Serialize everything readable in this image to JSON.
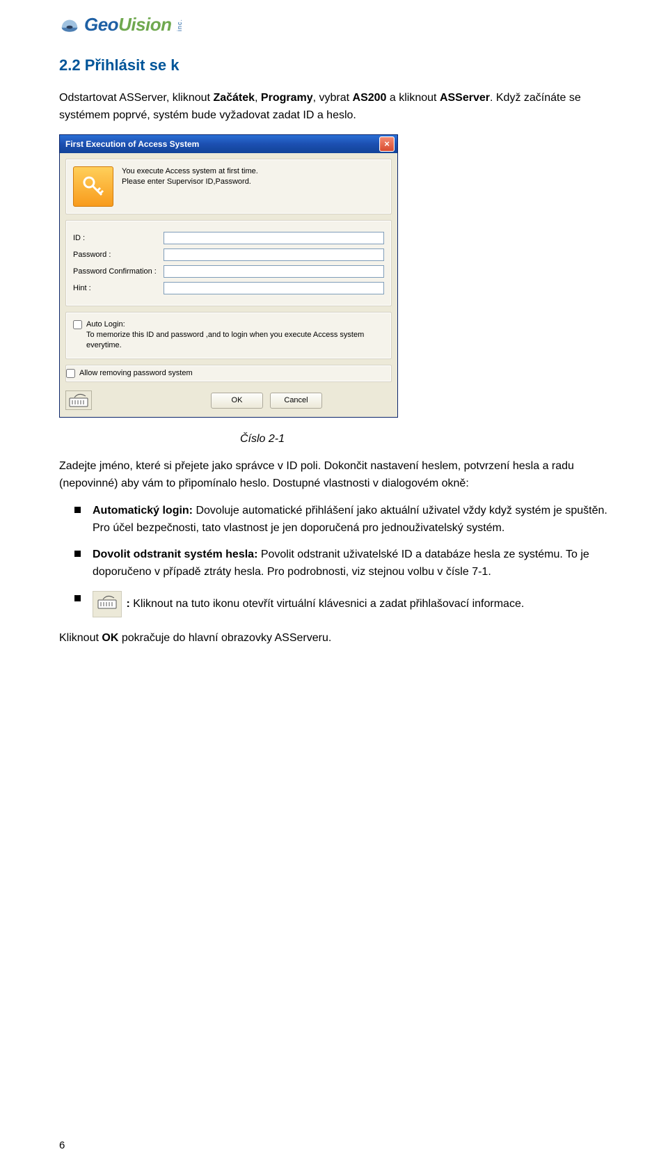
{
  "logo": {
    "brand1": "Geo",
    "brand2": "Uision",
    "side": "inc."
  },
  "section_heading": "2.2  Přihlásit se k",
  "intro_paragraphs": [
    {
      "prefix": "Odstartovat ASServer, kliknout ",
      "b1": "Začátek",
      "mid": ", ",
      "b2": "Programy",
      "mid2": ", vybrat ",
      "b3": "AS200",
      "mid3": " a kliknout ",
      "b4": "ASServer",
      "suffix": ". Když začínáte se systémem poprvé, systém bude vyžadovat zadat ID a heslo."
    }
  ],
  "dialog": {
    "title": "First Execution of Access System",
    "intro_line1": "You execute Access system at first time.",
    "intro_line2": "Please enter Supervisor ID,Password.",
    "labels": {
      "id": "ID :",
      "password": "Password :",
      "confirm": "Password Confirmation :",
      "hint": "Hint :"
    },
    "auto_login_label": "Auto Login:",
    "auto_login_desc": "To memorize this ID and password ,and to login when you execute Access system everytime.",
    "allow_remove": "Allow removing password system",
    "ok": "OK",
    "cancel": "Cancel",
    "close_icon": "×"
  },
  "figure_caption": "Číslo 2-1",
  "after_dialog_text": "Zadejte jméno, které si přejete jako správce v ID poli. Dokončit nastavení heslem, potvrzení hesla a radu (nepovinné) aby vám to připomínalo heslo. Dostupné vlastnosti v dialogovém okně:",
  "bullets": [
    {
      "bold": "Automatický login:",
      "rest": " Dovoluje automatické přihlášení jako aktuální uživatel vždy když systém je spuštěn. Pro účel bezpečnosti, tato vlastnost je jen doporučená pro jednouživatelský systém."
    },
    {
      "bold": "Dovolit odstranit systém hesla:",
      "rest": " Povolit odstranit uživatelské ID a databáze hesla ze systému. To je doporučeno v případě ztráty hesla. Pro podrobnosti, viz stejnou volbu v čísle 7-1."
    },
    {
      "icon": true,
      "bold": ":",
      "rest": " Kliknout na tuto ikonu otevřít virtuální klávesnici a zadat přihlašovací informace."
    }
  ],
  "closing_line_prefix": "Kliknout ",
  "closing_line_bold": "OK",
  "closing_line_suffix": " pokračuje do hlavní obrazovky ASServeru.",
  "page_number": "6"
}
